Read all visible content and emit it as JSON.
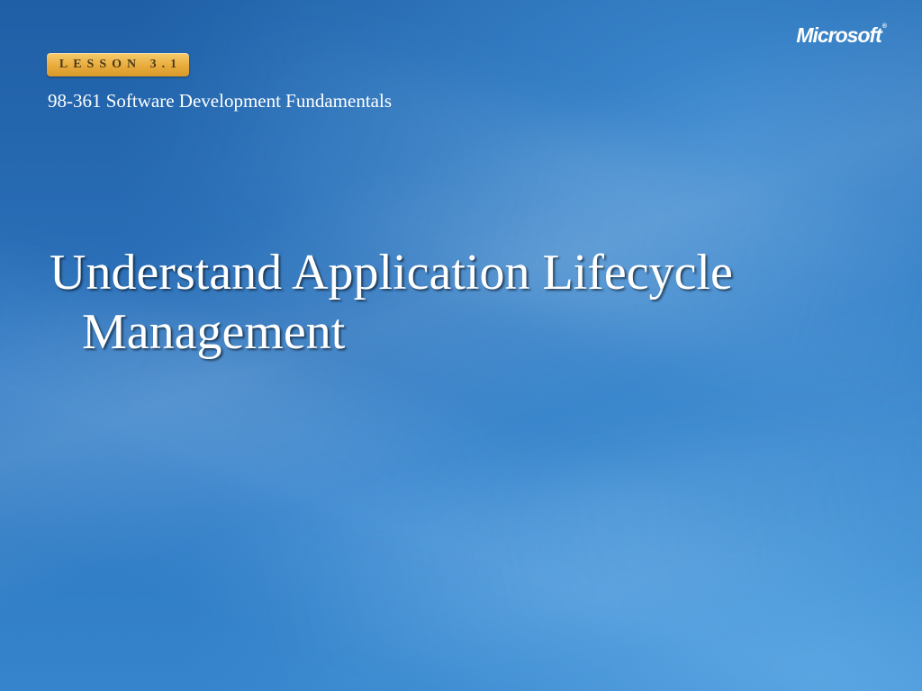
{
  "lesson_badge": {
    "label": "LESSON 3.1",
    "color": "#e8ab3c"
  },
  "course": {
    "title": "98-361 Software Development Fundamentals"
  },
  "logo": {
    "text": "Microsoft",
    "registered_mark": "®"
  },
  "slide": {
    "title": "Understand Application Lifecycle Management"
  },
  "colors": {
    "background": "#2a6fb8",
    "text": "#ffffff"
  }
}
